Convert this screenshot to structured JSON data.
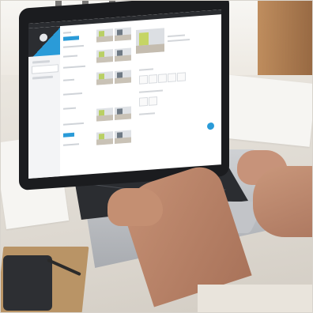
{
  "photo": {
    "subject": "laptop-on-desk",
    "colors": {
      "accent": "#2a9bd8",
      "screen_dark": "#2b2d31",
      "desk": "#e4dfd7",
      "skin": "#c48f72",
      "thumbnail_green": "#b9d064"
    }
  },
  "screen_ui": {
    "tab_title": "",
    "hero_title": ""
  }
}
